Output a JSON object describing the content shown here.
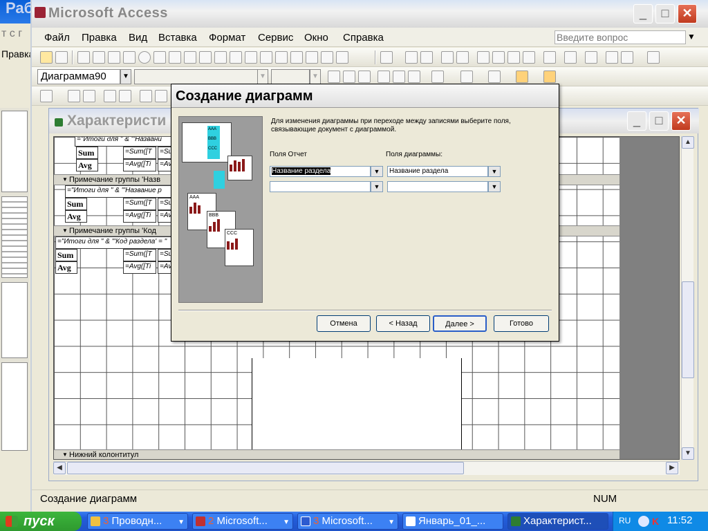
{
  "background_window": {
    "title_fragment": "Раб",
    "line1": "т с г",
    "line2": "Правка"
  },
  "app": {
    "title": "Microsoft Access",
    "menu": [
      "Файл",
      "Правка",
      "Вид",
      "Вставка",
      "Формат",
      "Сервис",
      "Окно",
      "Справка"
    ],
    "help_placeholder": "Введите вопрос",
    "object_combo": "Диаграмма90",
    "window_controls": {
      "minimize": "_",
      "maximize": "□",
      "close": "✕"
    }
  },
  "child_window": {
    "title": "Характеристи",
    "sections": [
      "Примечание группы 'Назв",
      "Примечание группы 'Код",
      "Нижний колонтитул"
    ],
    "fields": {
      "itogi1": "=\"Итоги для \" & \"'Названи",
      "itogi2": "=\"Итоги для \" & \"'Название р",
      "itogi3": "=\"Итоги для \" & \"'Код раздела' = \"",
      "sum_label": "Sum",
      "avg_label": "Avg",
      "sum_expr": "=Sum([Т",
      "avg_expr": "=Avg([Ti",
      "sum_short": "=Su",
      "avg_short": "=Av"
    }
  },
  "dialog": {
    "title": "Создание диаграмм",
    "instructions": "Для изменения диаграммы при переходе между записями выберите поля, связывающие документ с диаграммой.",
    "report_fields_label": "Поля Отчет",
    "chart_fields_label": "Поля диаграммы:",
    "report_field_1": "Название раздела",
    "report_field_2": "",
    "chart_field_1": "Название раздела",
    "chart_field_2": "",
    "pic_rows": [
      "AAA",
      "BBB",
      "CCC"
    ],
    "buttons": {
      "cancel": "Отмена",
      "back": "< Назад",
      "next": "Далее >",
      "finish": "Готово"
    }
  },
  "status": {
    "text": "Создание диаграмм",
    "num": "NUM"
  },
  "taskbar": {
    "start": "пуск",
    "tasks": [
      {
        "count": "3",
        "label": "Проводн..."
      },
      {
        "count": "2",
        "label": "Microsoft..."
      },
      {
        "count": "3",
        "label": "Microsoft..."
      },
      {
        "count": "",
        "label": "Январь_01_..."
      },
      {
        "count": "",
        "label": "Характерист..."
      }
    ],
    "lang": "RU",
    "clock": "11:52"
  }
}
